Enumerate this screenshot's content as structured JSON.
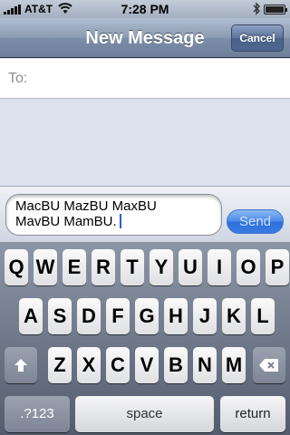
{
  "status_bar": {
    "carrier": "AT&T",
    "time": "7:28 PM"
  },
  "nav": {
    "title": "New Message",
    "cancel_label": "Cancel"
  },
  "to_field": {
    "label": "To:",
    "value": ""
  },
  "compose": {
    "message_line1": "MacBU MazBU MaxBU",
    "message_line2": "MavBU MamBU.",
    "send_label": "Send"
  },
  "keyboard": {
    "row1": [
      "Q",
      "W",
      "E",
      "R",
      "T",
      "Y",
      "U",
      "I",
      "O",
      "P"
    ],
    "row2": [
      "A",
      "S",
      "D",
      "F",
      "G",
      "H",
      "J",
      "K",
      "L"
    ],
    "row3": [
      "Z",
      "X",
      "C",
      "V",
      "B",
      "N",
      "M"
    ],
    "numbers_label": ".?123",
    "space_label": "space",
    "return_label": "return"
  },
  "icons": {
    "signal": "signal-bars-icon",
    "wifi": "wifi-icon",
    "bluetooth": "bluetooth-icon",
    "battery": "battery-icon",
    "shift": "shift-arrow-icon",
    "delete": "backspace-icon"
  },
  "colors": {
    "nav_bar": "#8b9bb3",
    "send_button": "#4a8ae8",
    "cursor": "#2463c9",
    "background": "#dbe2ed"
  }
}
